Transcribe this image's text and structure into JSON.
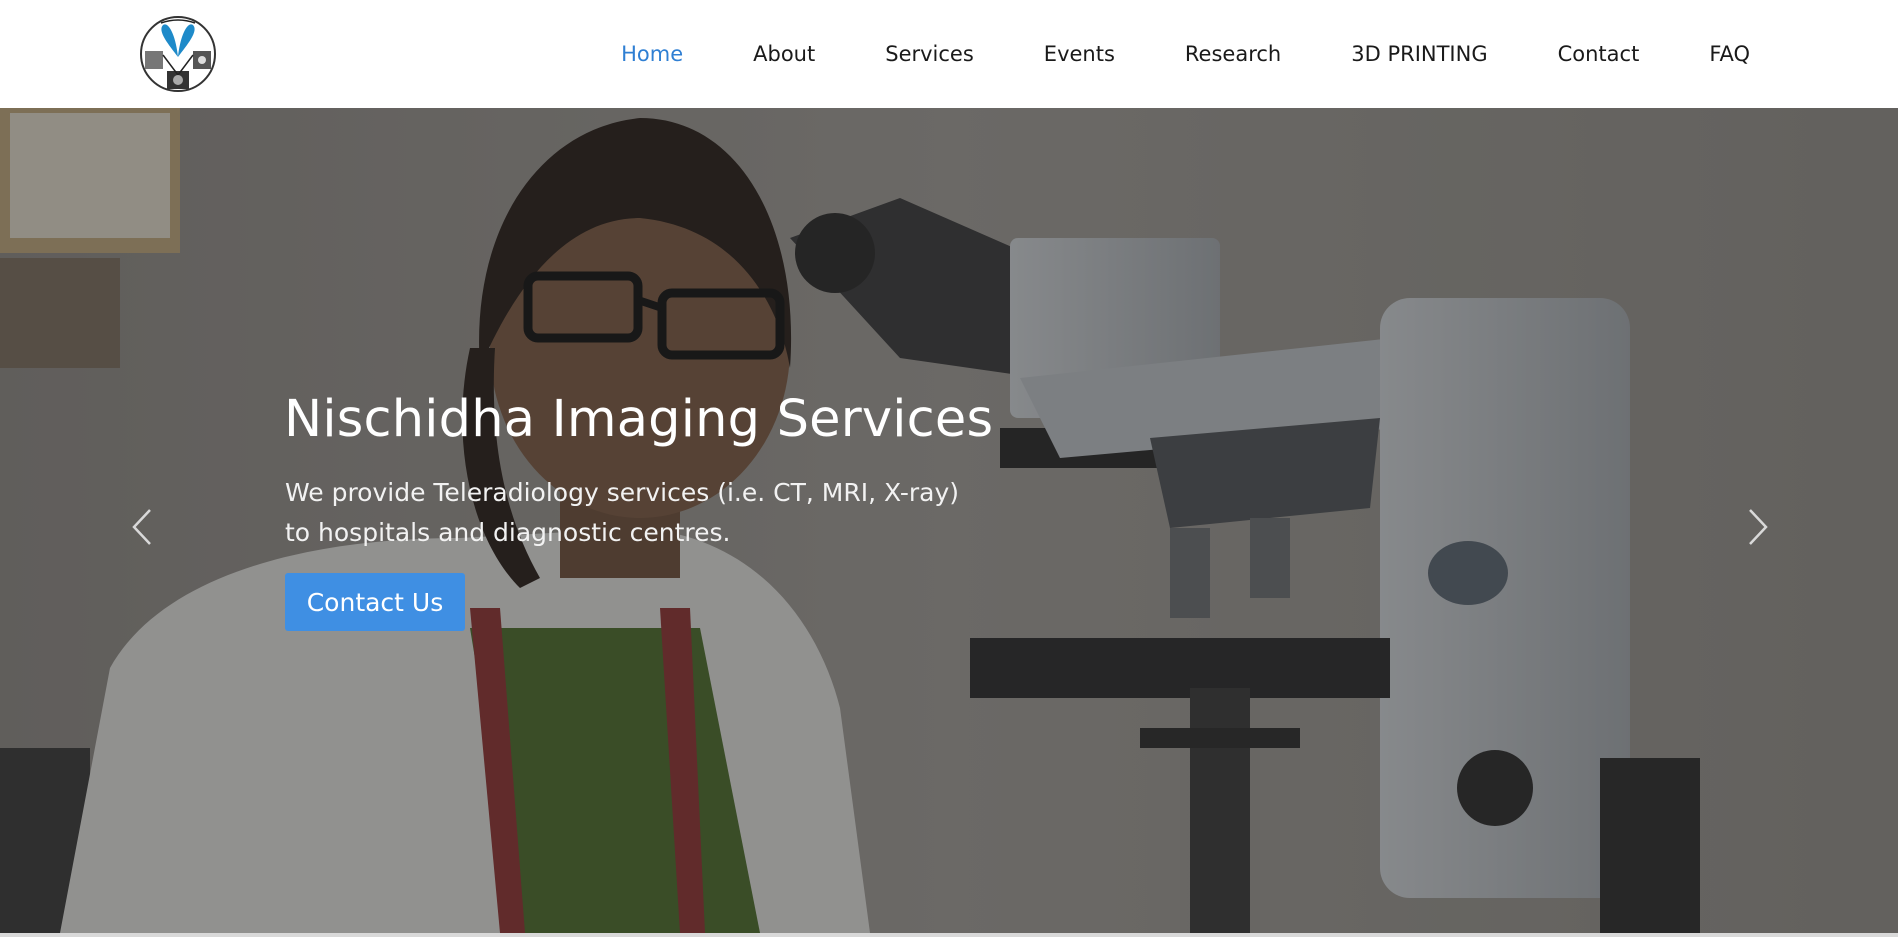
{
  "header": {
    "logo_icon": "radiology-logo-icon",
    "nav": [
      {
        "label": "Home",
        "active": true
      },
      {
        "label": "About"
      },
      {
        "label": "Services"
      },
      {
        "label": "Events"
      },
      {
        "label": "Research"
      },
      {
        "label": "3D PRINTING"
      },
      {
        "label": "Contact"
      },
      {
        "label": "FAQ"
      }
    ]
  },
  "hero": {
    "title": "Nischidha Imaging Services",
    "text_line1": "We provide Teleradiology services (i.e. CT, MRI, X-ray)",
    "text_line2": "to hospitals and diagnostic centres.",
    "button_label": "Contact Us",
    "prev_icon": "chevron-left-icon",
    "next_icon": "chevron-right-icon"
  },
  "colors": {
    "accent": "#2f7fd3",
    "button": "#3f8fe3",
    "header_bg": "#ffffff"
  }
}
